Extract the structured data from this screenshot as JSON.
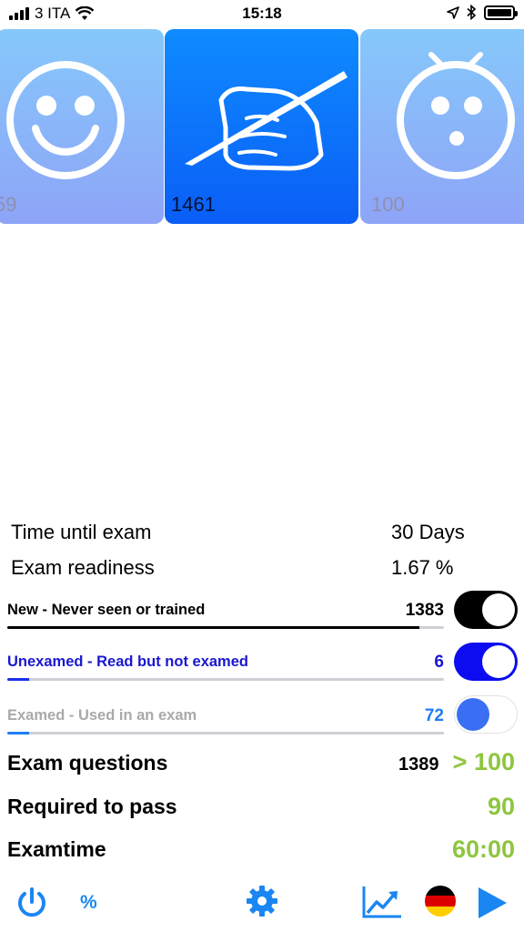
{
  "status_bar": {
    "carrier": "3 ITA",
    "time": "15:18"
  },
  "carousel": {
    "cards": [
      {
        "icon": "smiley-icon",
        "count": "59"
      },
      {
        "icon": "hand-writing-icon",
        "count": "1461"
      },
      {
        "icon": "alarm-clock-face-icon",
        "count": "100"
      }
    ]
  },
  "stats": {
    "time_until_exam_label": "Time until exam",
    "time_until_exam_value": "30 Days",
    "readiness_label": "Exam readiness",
    "readiness_value": "1.67 %"
  },
  "categories": [
    {
      "label": "New - Never seen or trained",
      "count": "1383",
      "progress": 0.944,
      "color": "#000000",
      "label_color": "#000000",
      "count_color": "#000000",
      "toggle_on": true,
      "toggle_color": "#000000"
    },
    {
      "label": "Unexamed - Read but not examed",
      "count": "6",
      "progress": 0.05,
      "color": "#1a30e8",
      "label_color": "#1a17cf",
      "count_color": "#1a17cf",
      "toggle_on": true,
      "toggle_color": "#0d0cf0"
    },
    {
      "label": "Examed - Used in an exam",
      "count": "72",
      "progress": 0.05,
      "color": "#1f7ef5",
      "label_color": "#a9a9a9",
      "count_color": "#1f7ef5",
      "toggle_on": false,
      "toggle_color": "#3a6ff3"
    }
  ],
  "exam": {
    "questions_label": "Exam questions",
    "questions_count": "1389",
    "questions_value": "> 100",
    "required_label": "Required to pass",
    "required_value": "90",
    "time_label": "Examtime",
    "time_value": "60:00"
  },
  "toolbar": {
    "percent_label": "%",
    "accent_color": "#1a86f2"
  }
}
